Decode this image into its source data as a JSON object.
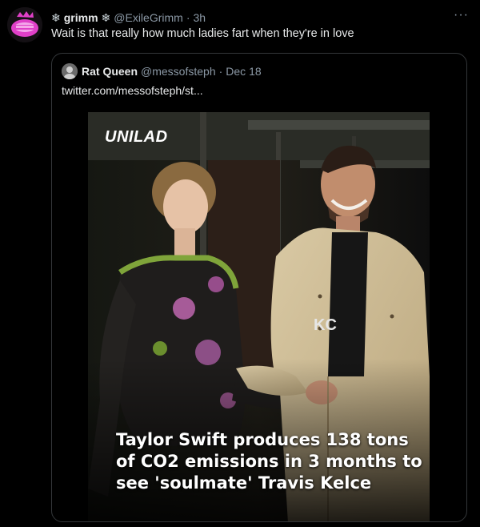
{
  "tweet": {
    "display_name": "grimm",
    "handle": "@ExileGrimm",
    "time": "3h",
    "text": "Wait is that really how much ladies fart when they're in love",
    "more_label": "···",
    "avatar_icon": "pink-avatar-icon"
  },
  "quoted": {
    "display_name": "Rat Queen",
    "handle": "@messofsteph",
    "date": "Dec 18",
    "link_text": "twitter.com/messofsteph/st...",
    "avatar_icon": "user-avatar-icon"
  },
  "media": {
    "brand": "UNILAD",
    "shirt_text": "KC",
    "caption_lines": [
      "Taylor Swift produces 138 tons",
      "of CO2 emissions in 3 months to",
      "see 'soulmate' Travis Kelce"
    ]
  },
  "colors": {
    "background": "#000000",
    "text": "#e7e9ea",
    "muted": "#8b98a5",
    "border": "#333639",
    "avatar_pink": "#e040c8"
  }
}
